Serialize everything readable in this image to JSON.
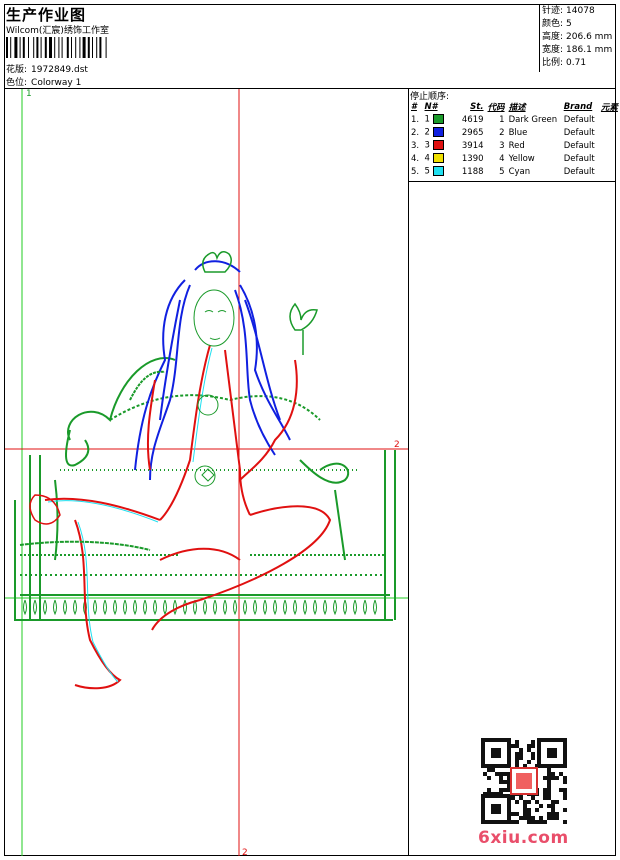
{
  "header": {
    "title": "生产作业图",
    "company": "Wilcom(汇宸)绣饰工作室",
    "design_label": "花版:",
    "design_value": "1972849.dst",
    "colorway_label": "色位:",
    "colorway_value": "Colorway 1"
  },
  "stats": [
    {
      "label": "针迹:",
      "value": "14078"
    },
    {
      "label": "颜色:",
      "value": "5"
    },
    {
      "label": "高度:",
      "value": "206.6 mm"
    },
    {
      "label": "宽度:",
      "value": "186.1 mm"
    },
    {
      "label": "比例:",
      "value": "0.71"
    }
  ],
  "stop_sequence": {
    "title": "停止顺序:",
    "headers": [
      "#",
      "N#",
      "St.",
      "代码",
      "描述",
      "Brand",
      "元素"
    ],
    "rows": [
      {
        "num": "1.",
        "n": "1",
        "color": "#1a9a2a",
        "stitches": "4619",
        "code": "1",
        "desc": "Dark Green",
        "brand": "Default",
        "element": ""
      },
      {
        "num": "2.",
        "n": "2",
        "color": "#1020e0",
        "stitches": "2965",
        "code": "2",
        "desc": "Blue",
        "brand": "Default",
        "element": ""
      },
      {
        "num": "3.",
        "n": "3",
        "color": "#e01010",
        "stitches": "3914",
        "code": "3",
        "desc": "Red",
        "brand": "Default",
        "element": ""
      },
      {
        "num": "4.",
        "n": "4",
        "color": "#f0e000",
        "stitches": "1390",
        "code": "4",
        "desc": "Yellow",
        "brand": "Default",
        "element": ""
      },
      {
        "num": "5.",
        "n": "5",
        "color": "#20e0f0",
        "stitches": "1188",
        "code": "5",
        "desc": "Cyan",
        "brand": "Default",
        "element": ""
      }
    ]
  },
  "markers": {
    "top_left": "1",
    "right": "2",
    "bottom": "2"
  },
  "watermark": {
    "text": "6xiu.com"
  },
  "colors": {
    "green": "#1a9a2a",
    "blue": "#1020e0",
    "red": "#e01010",
    "yellow": "#f0e000",
    "cyan": "#20e0f0"
  }
}
